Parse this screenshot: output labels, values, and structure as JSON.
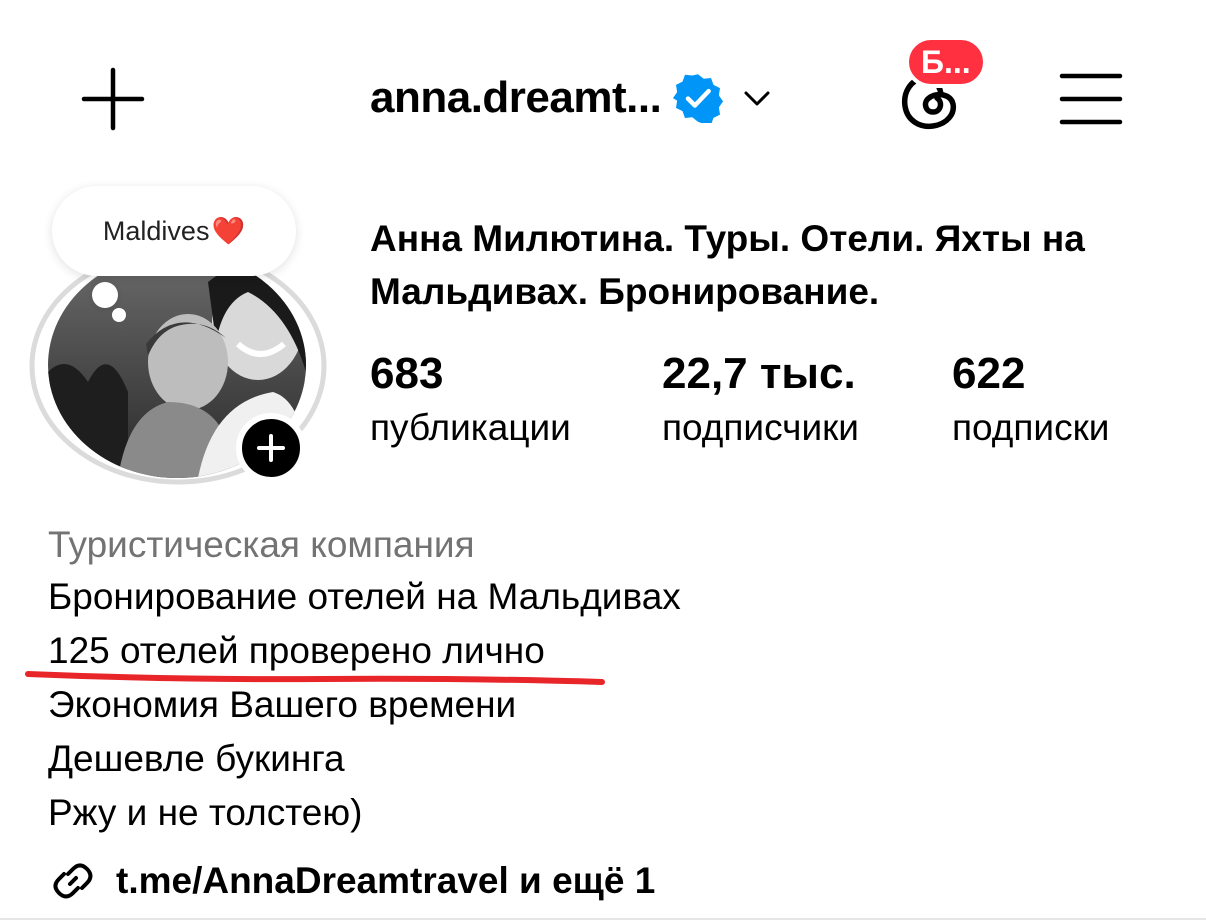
{
  "header": {
    "new_post_icon": "plus-icon",
    "username": "anna.dreamt...",
    "verified_icon": "verified-badge-icon",
    "account_switch_icon": "chevron-down-icon",
    "threads_icon": "threads-icon",
    "threads_badge": "Б...",
    "menu_icon": "hamburger-menu-icon"
  },
  "avatar": {
    "note_text": "Maldives",
    "note_emoji": "❤️",
    "add_story_icon": "plus-icon"
  },
  "profile": {
    "full_name": "Анна Милютина. Туры. Отели. Яхты на Мальдивах. Бронирование."
  },
  "stats": [
    {
      "value": "683",
      "label": "публикации"
    },
    {
      "value": "22,7 тыс.",
      "label": "подписчики"
    },
    {
      "value": "622",
      "label": "подписки"
    }
  ],
  "bio": {
    "category": "Туристическая компания",
    "lines": [
      "Бронирование отелей на Мальдивах",
      "125 отелей проверено лично",
      "Экономия Вашего времени",
      "Дешевле букинга",
      "Ржу и не толстею)"
    ]
  },
  "link": {
    "icon": "link-icon",
    "text": "t.me/AnnaDreamtravel и ещё 1"
  },
  "colors": {
    "verified_blue": "#0095f6",
    "badge_red": "#ff3040",
    "category_gray": "#737373",
    "annotation_red": "#e8262a"
  }
}
